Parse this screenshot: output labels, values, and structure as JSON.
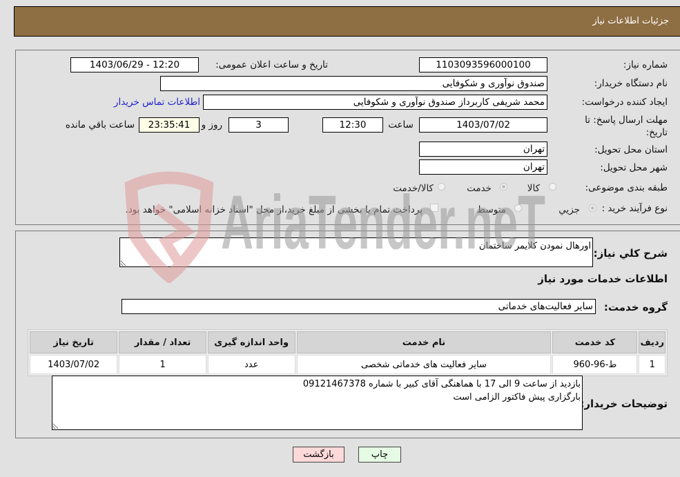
{
  "header": {
    "title": "جزئیات اطلاعات نیاز"
  },
  "form": {
    "need_number": {
      "label": "شماره نیاز:",
      "value": "1103093596000100"
    },
    "announce_datetime": {
      "label": "تاریخ و ساعت اعلان عمومی:",
      "value": "1403/06/29 - 12:20"
    },
    "buyer_org": {
      "label": "نام دستگاه خریدار:",
      "value": "صندوق نوآوری و شکوفایی"
    },
    "requester": {
      "label": "ایجاد کننده درخواست:",
      "value": "محمد  شریفی کاربرداز صندوق نوآوری و شکوفایی"
    },
    "buyer_contact_link": "اطلاعات تماس خریدار",
    "deadline": {
      "label": "مهلت ارسال پاسخ: تا تاریخ:",
      "date": "1403/07/02",
      "time_label": "ساعت",
      "time": "12:30",
      "days": "3",
      "days_label": "روز و",
      "remaining": "23:35:41",
      "remaining_label": "ساعت باقي مانده"
    },
    "province": {
      "label": "استان محل تحویل:",
      "value": "تهران"
    },
    "city": {
      "label": "شهر محل تحویل:",
      "value": "تهران"
    },
    "category": {
      "label": "طبقه بندی موضوعی:",
      "options": [
        {
          "label": "کالا",
          "checked": false
        },
        {
          "label": "خدمت",
          "checked": true
        },
        {
          "label": "کالا/خدمت",
          "checked": false
        }
      ]
    },
    "purchase_type": {
      "label": "نوع فرآیند خرید :",
      "options": [
        {
          "label": "جزيي",
          "checked": true
        },
        {
          "label": "متوسط",
          "checked": false
        }
      ],
      "treasury_note": "پرداخت تمام یا بخشی از مبلغ خرید،از محل \"اسناد خزانه اسلامی\" خواهد بود.",
      "treasury_checked": false
    }
  },
  "details": {
    "general_desc": {
      "label": "شرح کلي نیاز:",
      "value": "اورهال نمودن کلایمر ساختمان"
    },
    "services_heading": "اطلاعات خدمات مورد نیاز",
    "service_group": {
      "label": "گروه خدمت:",
      "value": "سایر فعالیت‌های خدماتی"
    },
    "table": {
      "headers": [
        "ردیف",
        "کد خدمت",
        "نام خدمت",
        "واحد اندازه گیری",
        "تعداد / مقدار",
        "تاریخ نیاز"
      ],
      "rows": [
        [
          "1",
          "ط-96-960",
          "سایر فعالیت های خدماتی شخصی",
          "عدد",
          "1",
          "1403/07/02"
        ]
      ]
    },
    "buyer_notes": {
      "label": "توضیحات خریدار:",
      "value": "بازدید از ساعت 9 الی 17 با هماهنگی آقای کبیر با شماره 09121467378\nبارگزاری پیش فاکتور الزامی است"
    }
  },
  "buttons": {
    "back": "بازگشت",
    "print": "چاپ"
  },
  "watermark": {
    "text": "AriaTender.neT"
  },
  "colors": {
    "header_bg": "#8e6e43",
    "back_bg": "#fdd9d9",
    "print_bg": "#e6fbe3",
    "link": "#2222cc"
  }
}
